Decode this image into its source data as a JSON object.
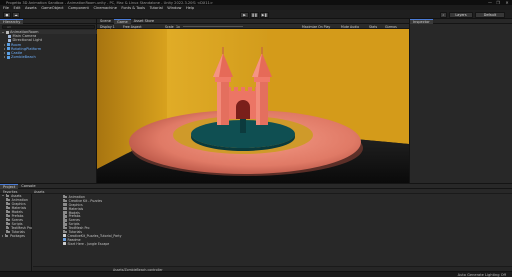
{
  "window": {
    "title": "Progetto 3D Animation Sandbox - AnimationRoom.unity - PC, Mac & Linux Standalone - Unity 2022.3.20f1 <DX11>",
    "controls": [
      "—",
      "❐",
      "✕"
    ]
  },
  "menu": [
    "File",
    "Edit",
    "Assets",
    "GameObject",
    "Component",
    "Cinemachine",
    "Fonts & Tools",
    "Tutorial",
    "Window",
    "Help"
  ],
  "toolbar": {
    "account": "Account",
    "cloud": "☁",
    "play": "▶",
    "pause": "❚❚",
    "step": "▶❚",
    "search": "⌕",
    "layers": "Layers",
    "layout": "Default"
  },
  "hierarchy": {
    "tab": "Hierarchy",
    "search_placeholder": "All",
    "rows": [
      {
        "label": "AnimationRoom",
        "indent": 0,
        "type": "scene"
      },
      {
        "label": "Main Camera",
        "indent": 1,
        "type": "object"
      },
      {
        "label": "Directional Light",
        "indent": 1,
        "type": "object"
      },
      {
        "label": "Room",
        "indent": 1,
        "type": "prefab"
      },
      {
        "label": "RotatingPlatform",
        "indent": 1,
        "type": "prefab"
      },
      {
        "label": "Castle",
        "indent": 1,
        "type": "prefab"
      },
      {
        "label": "ZombieBeach",
        "indent": 1,
        "type": "prefab"
      }
    ]
  },
  "scene": {
    "tabs": [
      "Scene",
      "Game",
      "Asset Store"
    ],
    "tool_left": [
      "Display 1",
      "Free Aspect"
    ],
    "scale_label": "Scale",
    "scale_value": "1x",
    "tool_right": [
      "Maximize On Play",
      "Mute Audio",
      "Stats",
      "Gizmos"
    ]
  },
  "inspector": {
    "tab": "Inspector"
  },
  "project": {
    "tabs": [
      "Project",
      "Console"
    ],
    "favorites": "Favorites",
    "tree": [
      {
        "label": "Assets",
        "indent": 0
      },
      {
        "label": "Animation",
        "indent": 1
      },
      {
        "label": "Graphics",
        "indent": 1
      },
      {
        "label": "Materials",
        "indent": 1
      },
      {
        "label": "Models",
        "indent": 1
      },
      {
        "label": "Prefabs",
        "indent": 1
      },
      {
        "label": "Scenes",
        "indent": 1
      },
      {
        "label": "Scripts",
        "indent": 1
      },
      {
        "label": "TextMesh Pro",
        "indent": 1
      },
      {
        "label": "Tutorials",
        "indent": 1
      },
      {
        "label": "Packages",
        "indent": 0
      }
    ],
    "breadcrumb": "Assets",
    "files": [
      {
        "label": "Animation",
        "kind": "folder"
      },
      {
        "label": "Creative Kit - Puzzles",
        "kind": "folder"
      },
      {
        "label": "Graphics",
        "kind": "folder"
      },
      {
        "label": "Materials",
        "kind": "folder"
      },
      {
        "label": "Models",
        "kind": "folder"
      },
      {
        "label": "Prefabs",
        "kind": "folder"
      },
      {
        "label": "Scenes",
        "kind": "folder"
      },
      {
        "label": "Scripts",
        "kind": "folder"
      },
      {
        "label": "TextMesh Pro",
        "kind": "folder"
      },
      {
        "label": "Tutorials",
        "kind": "folder"
      },
      {
        "label": "CreativeKit_Puzzles_Tutorial_Party",
        "kind": "file"
      },
      {
        "label": "Readme",
        "kind": "file"
      },
      {
        "label": "Start Here - Jungle Escape",
        "kind": "file"
      }
    ],
    "footer": "Assets/ZombieBeach.controller"
  },
  "status": "Auto Generate Lighting Off",
  "colors": {
    "wall": "#d9a21f",
    "floor": "#161616",
    "platform_outer": "#e8826c",
    "platform_ring": "#d8a02a",
    "platform_center": "#0f4f52",
    "castle": "#f07a6a",
    "accent": "#4a7bd6"
  }
}
